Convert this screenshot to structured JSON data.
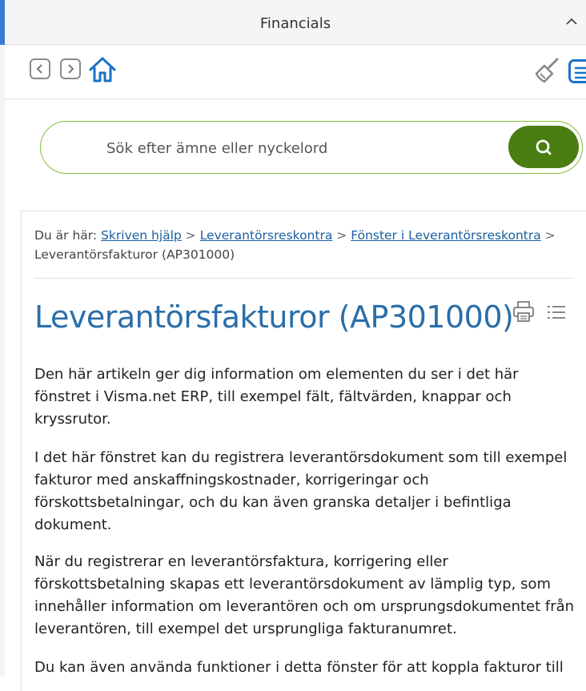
{
  "window": {
    "title": "Financials"
  },
  "search": {
    "placeholder": "Sök efter ämne eller nyckelord"
  },
  "breadcrumb": {
    "prefix": "Du är här:",
    "links": [
      "Skriven hjälp",
      "Leverantörsreskontra",
      "Fönster i Leverantörsreskontra"
    ],
    "separator": ">",
    "current": "Leverantörsfakturor (AP301000)"
  },
  "article": {
    "title": "Leverantörsfakturor (AP301000)",
    "paragraphs": [
      "Den här artikeln ger dig information om elementen du ser i det här fönstret i Visma.net ERP, till exempel fält, fältvärden, knappar och kryssrutor.",
      "I det här fönstret kan du registrera leverantörsdokument som till exempel fakturor med anskaffningskostnader, korrigeringar och förskottsbetalningar, och du kan även granska detaljer i befintliga dokument.",
      "När du registrerar en leverantörsfaktura, korrigering eller förskottsbetalning skapas ett leverantörsdokument av lämplig typ, som innehåller information om leverantören och om ursprungsdokumentet från leverantören, till exempel det ursprungliga fakturanumret.",
      "Du kan även använda funktioner i detta fönster för att koppla fakturor till"
    ]
  },
  "icons": {
    "back": "chevron-left-icon",
    "forward": "chevron-right-icon",
    "home": "home-icon",
    "broom": "broom-icon",
    "menu": "menu-icon",
    "search": "search-icon",
    "print": "print-icon",
    "toc": "list-icon"
  },
  "colors": {
    "accent": "#4a7d12",
    "search_border": "#7fbf3a",
    "title": "#2a6ea8",
    "link": "#1a5fa3",
    "home_icon": "#1a73c8"
  }
}
